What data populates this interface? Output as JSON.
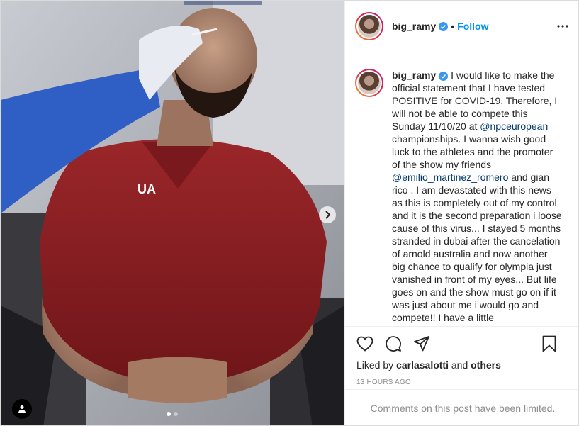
{
  "post": {
    "username": "big_ramy",
    "separator": "•",
    "follow_label": "Follow",
    "caption_parts": {
      "p1": "I would like to make the official statement that I have tested POSITIVE for COVID-19. Therefore, I will not be able to compete this Sunday 11/10/20 at ",
      "m1": "@npceuropean",
      "p2": " championships. I wanna wish good luck to the athletes and the promoter of the show my friends ",
      "m2": "@emilio_martinez_romero",
      "p3": " and gian rico . I am devastated with this news as this is completely out of my control and it is the second preparation i loose cause of this virus... I stayed 5 months stranded in dubai after the cancelation of arnold australia and now another big chance to qualify for olympia just vanished in front of my eyes... But life goes on and the show must go on if it was just about me i would go and compete!! I have a little"
    },
    "liked_by_prefix": "Liked by ",
    "liked_by_user": "carlasalotti",
    "liked_by_and": " and ",
    "liked_by_others": "others",
    "timestamp": "13 HOURS AGO",
    "comments_limited": "Comments on this post have been limited.",
    "carousel": {
      "total_slides": 2,
      "active_slide": 1
    }
  },
  "icons": {
    "more": "more-options-icon",
    "like": "heart-icon",
    "comment": "comment-icon",
    "share": "paper-plane-icon",
    "save": "bookmark-icon",
    "next": "chevron-right-icon",
    "tags": "user-tag-icon",
    "verified": "verified-badge-icon"
  },
  "colors": {
    "accent": "#0095f6",
    "verified": "#3897f0",
    "mention": "#00376b",
    "muted": "#8e8e8e",
    "shirt": "#8d1f24"
  }
}
